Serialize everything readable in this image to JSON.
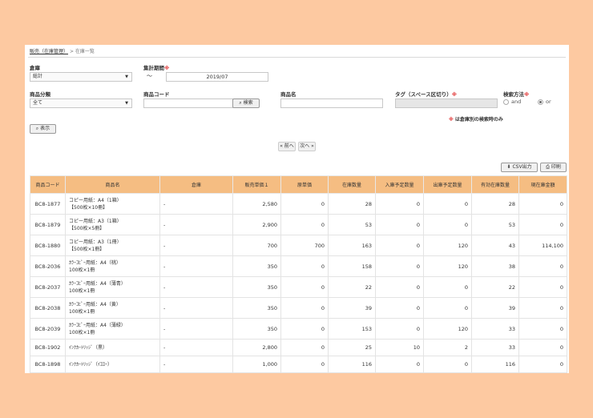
{
  "breadcrumb": {
    "link": "販売（在庫管理）",
    "sep": ">",
    "current": "在庫一覧"
  },
  "form": {
    "warehouse": {
      "label": "倉庫",
      "value": "総計"
    },
    "period": {
      "label": "集計期間",
      "required_mark": "※",
      "tilde": "〜",
      "value": "2019/07"
    },
    "category": {
      "label": "商品分類",
      "value": "全て"
    },
    "product_code": {
      "label": "商品コード",
      "value": "",
      "search_button": "検索"
    },
    "product_name": {
      "label": "商品名",
      "value": ""
    },
    "tag": {
      "label": "タグ（スペース区切り）",
      "required_mark": "※",
      "value": ""
    },
    "method": {
      "label": "検索方法",
      "required_mark": "※",
      "options": [
        "and",
        "or"
      ],
      "selected": "or"
    },
    "note": {
      "mark": "※",
      "text": "は倉庫別の検索時のみ"
    },
    "show_button": "表示"
  },
  "pager": {
    "prev": "« 前へ",
    "next": "次へ »"
  },
  "actions": {
    "csv": "CSV出力",
    "print": "印刷"
  },
  "table": {
    "headers": [
      "商品コード",
      "商品名",
      "倉庫",
      "販売単価１",
      "原単価",
      "在庫数量",
      "入庫予定数量",
      "出庫予定数量",
      "有効在庫数量",
      "現在庫金額"
    ],
    "rows": [
      {
        "code": "BC8-1877",
        "name1": "コピー用紙：A4（1箱）",
        "name2": "【500枚×10冊】",
        "warehouse": "-",
        "price": "2,580",
        "cost": "0",
        "stock": "28",
        "incoming": "0",
        "outgoing": "0",
        "available": "28",
        "amount": "0"
      },
      {
        "code": "BC8-1879",
        "name1": "コピー用紙：A3（1箱）",
        "name2": "【500枚×5冊】",
        "warehouse": "-",
        "price": "2,900",
        "cost": "0",
        "stock": "53",
        "incoming": "0",
        "outgoing": "0",
        "available": "53",
        "amount": "0"
      },
      {
        "code": "BC8-1880",
        "name1": "コピー用紙：A3（1冊）",
        "name2": "【500枚×1冊】",
        "warehouse": "-",
        "price": "700",
        "cost": "700",
        "stock": "163",
        "incoming": "0",
        "outgoing": "120",
        "available": "43",
        "amount": "114,100"
      },
      {
        "code": "BC8-2036",
        "name1": "ｶﾗｰｺﾋﾟｰ用紙：A4（桃）",
        "name2": "100枚×1冊",
        "warehouse": "-",
        "price": "350",
        "cost": "0",
        "stock": "158",
        "incoming": "0",
        "outgoing": "120",
        "available": "38",
        "amount": "0"
      },
      {
        "code": "BC8-2037",
        "name1": "ｶﾗｰｺﾋﾟｰ用紙：A4（薄青）",
        "name2": "100枚×1冊",
        "warehouse": "-",
        "price": "350",
        "cost": "0",
        "stock": "22",
        "incoming": "0",
        "outgoing": "0",
        "available": "22",
        "amount": "0"
      },
      {
        "code": "BC8-2038",
        "name1": "ｶﾗｰｺﾋﾟｰ用紙：A4（黄）",
        "name2": "100枚×1冊",
        "warehouse": "-",
        "price": "350",
        "cost": "0",
        "stock": "39",
        "incoming": "0",
        "outgoing": "0",
        "available": "39",
        "amount": "0"
      },
      {
        "code": "BC8-2039",
        "name1": "ｶﾗｰｺﾋﾟｰ用紙：A4（薄緑）",
        "name2": "100枚×1冊",
        "warehouse": "-",
        "price": "350",
        "cost": "0",
        "stock": "153",
        "incoming": "0",
        "outgoing": "120",
        "available": "33",
        "amount": "0"
      },
      {
        "code": "BC8-1902",
        "name1": "ｲﾝｸｶｰﾄﾘｯｼﾞ（黒）",
        "name2": "",
        "warehouse": "-",
        "price": "2,800",
        "cost": "0",
        "stock": "25",
        "incoming": "10",
        "outgoing": "2",
        "available": "33",
        "amount": "0"
      },
      {
        "code": "BC8-1898",
        "name1": "ｲﾝｸｶｰﾄﾘｯｼﾞ（ｲｴﾛｰ）",
        "name2": "",
        "warehouse": "-",
        "price": "1,000",
        "cost": "0",
        "stock": "116",
        "incoming": "0",
        "outgoing": "0",
        "available": "116",
        "amount": "0"
      }
    ]
  },
  "colors": {
    "background": "#fdc9a1",
    "header": "#f5bd82",
    "required": "#e03030"
  }
}
